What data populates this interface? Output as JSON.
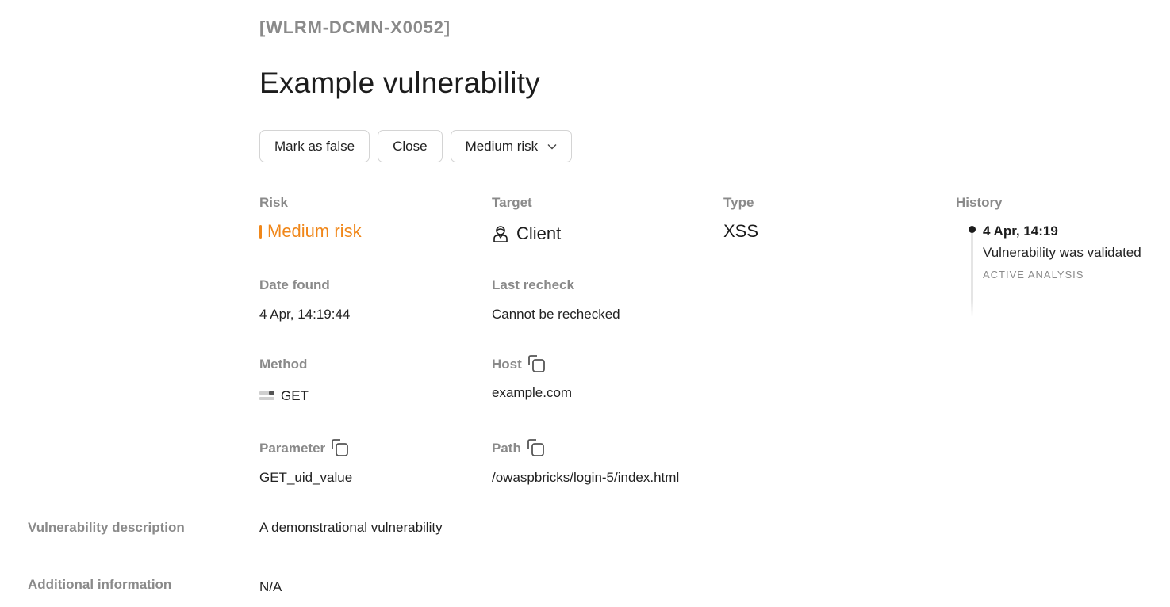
{
  "header": {
    "vuln_id": "[WLRM-DCMN-X0052]",
    "title": "Example vulnerability"
  },
  "actions": {
    "mark_false_label": "Mark as false",
    "close_label": "Close",
    "risk_select_value": "Medium risk"
  },
  "fields": {
    "risk": {
      "label": "Risk",
      "value": "Medium risk",
      "color": "#f0871a"
    },
    "target": {
      "label": "Target",
      "value": "Client",
      "icon": "user-icon"
    },
    "type": {
      "label": "Type",
      "value": "XSS"
    },
    "date_found": {
      "label": "Date found",
      "value": "4 Apr, 14:19:44"
    },
    "last_recheck": {
      "label": "Last recheck",
      "value": "Cannot be rechecked"
    },
    "method": {
      "label": "Method",
      "value": "GET",
      "icon": "method-icon"
    },
    "host": {
      "label": "Host",
      "value": "example.com",
      "icon": "copy-icon"
    },
    "parameter": {
      "label": "Parameter",
      "value": "GET_uid_value",
      "icon": "copy-icon"
    },
    "path": {
      "label": "Path",
      "value": "/owaspbricks/login-5/index.html",
      "icon": "copy-icon"
    }
  },
  "history": {
    "label": "History",
    "events": [
      {
        "date": "4 Apr, 14:19",
        "text": "Vulnerability was validated",
        "tag": "ACTIVE ANALYSIS"
      }
    ]
  },
  "details": {
    "description_label": "Vulnerability description",
    "description_value": "A demonstrational vulnerability",
    "additional_label": "Additional information",
    "additional_value": "N/A"
  }
}
